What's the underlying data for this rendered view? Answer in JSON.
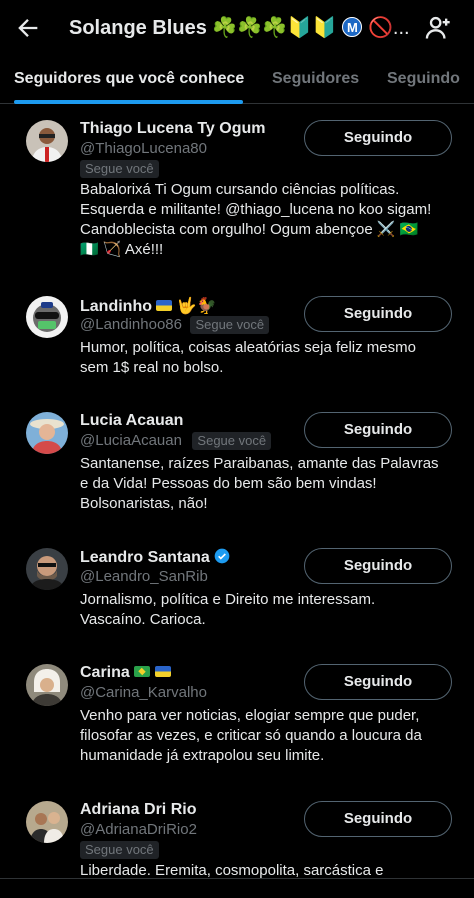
{
  "header": {
    "title": "Solange Blues",
    "title_emojis": "☘️☘️☘️🔰🔰",
    "title_m": "M",
    "title_tail": "🚫...",
    "back_icon": "arrow-left-icon",
    "add_icon": "person-add-icon"
  },
  "tabs": [
    {
      "label": "Seguidores que você conhece",
      "active": true
    },
    {
      "label": "Seguidores",
      "active": false
    },
    {
      "label": "Seguindo",
      "active": false
    }
  ],
  "users": [
    {
      "name": "Thiago Lucena Ty Ogum",
      "handle": "@ThiagoLucena80",
      "badge": "Segue você",
      "button": "Seguindo",
      "bio": "Babalorixá Ti Ogum cursando ciências políticas. Esquerda e militante! @thiago_lucena no koo sigam! Candoblecista com orgulho! Ogum abençoe ⚔️ 🇧🇷 🇳🇬 🏹 Axé!!!"
    },
    {
      "name": "Landinho",
      "name_emojis": "🤟🐓",
      "handle": "@Landinhoo86",
      "badge": "Segue você",
      "button": "Seguindo",
      "bio": "Humor, política, coisas aleatórias seja feliz mesmo sem 1$ real no bolso."
    },
    {
      "name": "Lucia Acauan",
      "handle": "@LuciaAcauan",
      "badge": "Segue você",
      "button": "Seguindo",
      "bio": "Santanense, raízes Paraibanas, amante das Palavras e da Vida! Pessoas do bem são bem vindas! Bolsonaristas, não!"
    },
    {
      "name": "Leandro Santana",
      "handle": "@Leandro_SanRib",
      "button": "Seguindo",
      "bio": "Jornalismo, política e Direito me interessam. Vascaíno. Carioca."
    },
    {
      "name": "Carina",
      "handle": "@Carina_Karvalho",
      "button": "Seguindo",
      "bio": "Venho para ver noticias, elogiar sempre que puder, filosofar as vezes, e criticar só quando a loucura da humanidade já extrapolou seu limite."
    },
    {
      "name": "Adriana Dri Rio",
      "handle": "@AdrianaDriRio2",
      "badge": "Segue você",
      "button": "Seguindo",
      "bio": "Liberdade. Eremita, cosmopolita, sarcástica e"
    }
  ],
  "colors": {
    "background": "#000000",
    "text": "#e7e9ea",
    "muted": "#71767b",
    "accent": "#1d9bf0"
  }
}
